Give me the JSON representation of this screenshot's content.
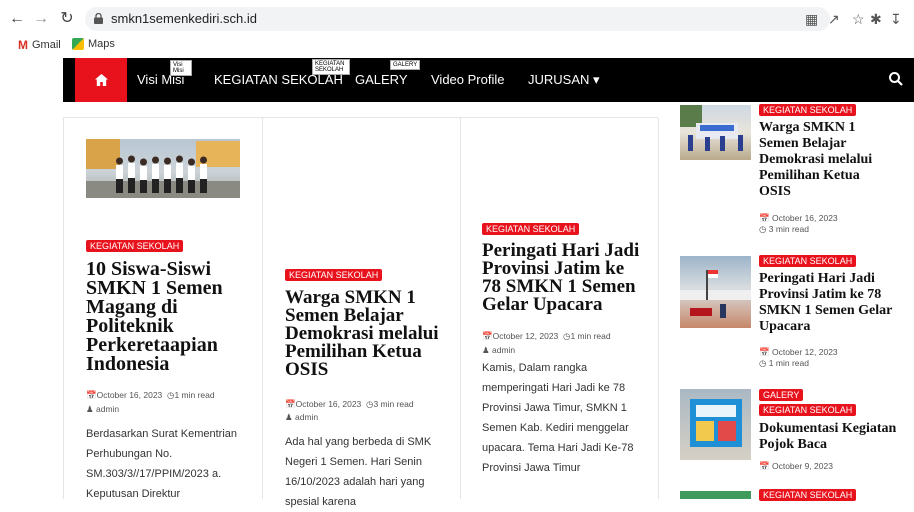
{
  "browser": {
    "url": "smkn1semenkediri.sch.id",
    "bookmarks": [
      {
        "label": "Gmail"
      },
      {
        "label": "Maps"
      }
    ]
  },
  "nav": {
    "items": [
      {
        "label": "Visi Misi",
        "tooltip": "Visi Misi"
      },
      {
        "label": "KEGIATAN SEKOLAH",
        "tooltip": "KEGIATAN SEKOLAH"
      },
      {
        "label": "GALERY",
        "tooltip": "GALERY"
      },
      {
        "label": "Video Profile"
      },
      {
        "label": "JURUSAN ▾"
      }
    ]
  },
  "posts": [
    {
      "category": "KEGIATAN SEKOLAH",
      "title": "10 Siswa-Siswi SMKN 1 Semen Magang di Politeknik Perkeretaapian Indonesia",
      "date": "October 16, 2023",
      "read": "1 min read",
      "author": "admin",
      "excerpt": "Berdasarkan Surat Kementrian Perhubungan No. SM.303/3//17/PPIM/2023 a. Keputusan Direktur"
    },
    {
      "category": "KEGIATAN SEKOLAH",
      "title": "Warga SMKN 1 Semen Belajar Demokrasi melalui Pemilihan Ketua OSIS",
      "date": "October 16, 2023",
      "read": "3 min read",
      "author": "admin",
      "excerpt": "Ada hal yang berbeda di SMK Negeri 1 Semen. Hari Senin 16/10/2023 adalah hari yang spesial karena"
    },
    {
      "category": "KEGIATAN SEKOLAH",
      "title": "Peringati Hari Jadi Provinsi Jatim ke 78 SMKN 1 Semen Gelar Upacara",
      "date": "October 12, 2023",
      "read": "1 min read",
      "author": "admin",
      "excerpt": "Kamis, Dalam rangka memperingati Hari Jadi ke 78 Provinsi Jawa Timur, SMKN 1 Semen Kab. Kediri menggelar upacara. Tema Hari Jadi Ke-78 Provinsi Jawa Timur"
    }
  ],
  "sidebar": [
    {
      "categories": [
        "KEGIATAN SEKOLAH"
      ],
      "title": "Warga SMKN 1 Semen Belajar Demokrasi melalui Pemilihan Ketua OSIS",
      "date": "October 16, 2023",
      "read": "3 min read"
    },
    {
      "categories": [
        "KEGIATAN SEKOLAH"
      ],
      "title": "Peringati Hari Jadi Provinsi Jatim ke 78 SMKN 1 Semen Gelar Upacara",
      "date": "October 12, 2023",
      "read": "1 min read"
    },
    {
      "categories": [
        "GALERY",
        "KEGIATAN SEKOLAH"
      ],
      "title": "Dokumentasi Kegiatan Pojok Baca",
      "date": "October 9, 2023"
    },
    {
      "categories": [
        "KEGIATAN SEKOLAH"
      ]
    }
  ],
  "colors": {
    "accent": "#e8121d",
    "navbar": "#000000"
  }
}
